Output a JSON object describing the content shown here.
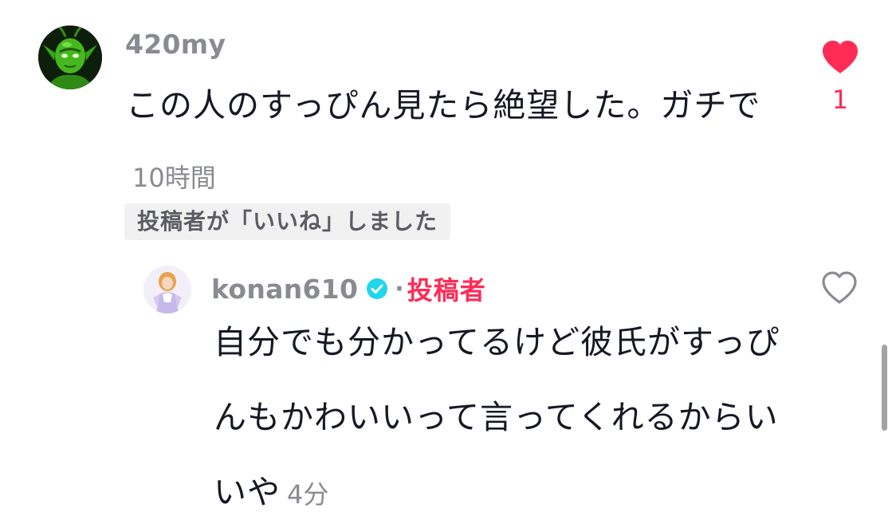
{
  "comment": {
    "username": "420my",
    "text": "この人のすっぴん見たら絶望した。ガチで",
    "timestamp": "10時間",
    "like_count": "1",
    "liked": true,
    "liked_by_creator_label": "投稿者が「いいね」しました"
  },
  "reply": {
    "username": "konan610",
    "verified": true,
    "separator": "·",
    "creator_label": "投稿者",
    "text": "自分でも分かってるけど彼氏がすっぴんもかわいいって言ってくれるからいいや",
    "timestamp": "4分",
    "liked": false
  },
  "icons": {
    "like": "heart-icon",
    "verified": "verified-badge-icon"
  },
  "colors": {
    "accent": "#fe2c55",
    "verified": "#20d5ec",
    "secondary_text": "#8a8b91",
    "primary_text": "#161823"
  }
}
